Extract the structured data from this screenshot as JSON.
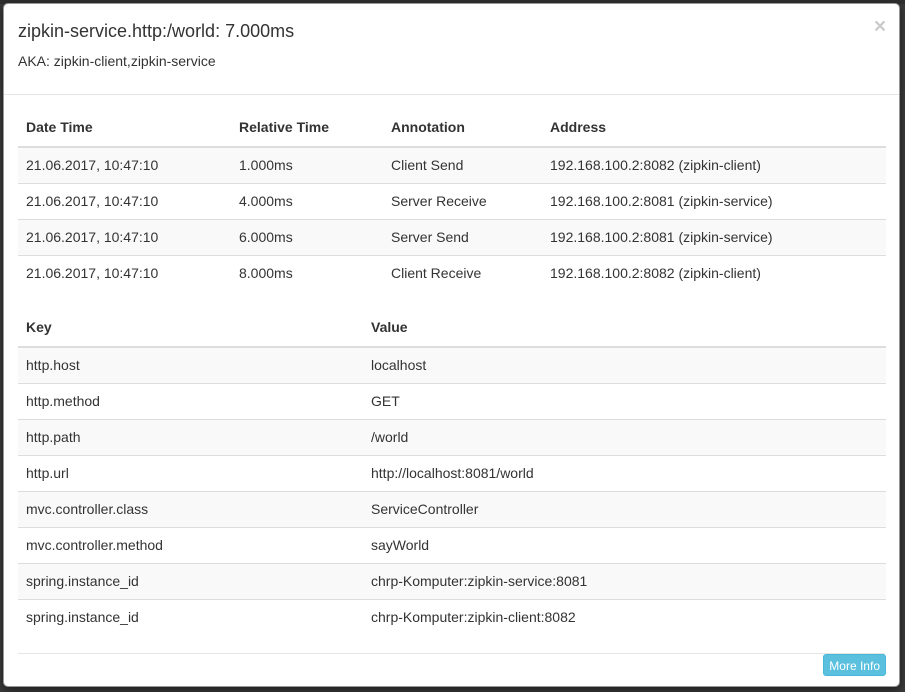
{
  "modal": {
    "title": "zipkin-service.http:/world: 7.000ms",
    "aka": "AKA: zipkin-client,zipkin-service",
    "close_label": "×"
  },
  "annotations": {
    "headers": [
      "Date Time",
      "Relative Time",
      "Annotation",
      "Address"
    ],
    "rows": [
      [
        "21.06.2017, 10:47:10",
        "1.000ms",
        "Client Send",
        "192.168.100.2:8082 (zipkin-client)"
      ],
      [
        "21.06.2017, 10:47:10",
        "4.000ms",
        "Server Receive",
        "192.168.100.2:8081 (zipkin-service)"
      ],
      [
        "21.06.2017, 10:47:10",
        "6.000ms",
        "Server Send",
        "192.168.100.2:8081 (zipkin-service)"
      ],
      [
        "21.06.2017, 10:47:10",
        "8.000ms",
        "Client Receive",
        "192.168.100.2:8082 (zipkin-client)"
      ]
    ]
  },
  "tags": {
    "headers": [
      "Key",
      "Value"
    ],
    "rows": [
      [
        "http.host",
        "localhost"
      ],
      [
        "http.method",
        "GET"
      ],
      [
        "http.path",
        "/world"
      ],
      [
        "http.url",
        "http://localhost:8081/world"
      ],
      [
        "mvc.controller.class",
        "ServiceController"
      ],
      [
        "mvc.controller.method",
        "sayWorld"
      ],
      [
        "spring.instance_id",
        "chrp-Komputer:zipkin-service:8081"
      ],
      [
        "spring.instance_id",
        "chrp-Komputer:zipkin-client:8082"
      ]
    ]
  },
  "footer": {
    "more_info_label": "More Info"
  },
  "colors": {
    "info_button": "#5bc0de",
    "stripe": "#f9f9f9",
    "border": "#dddddd"
  }
}
